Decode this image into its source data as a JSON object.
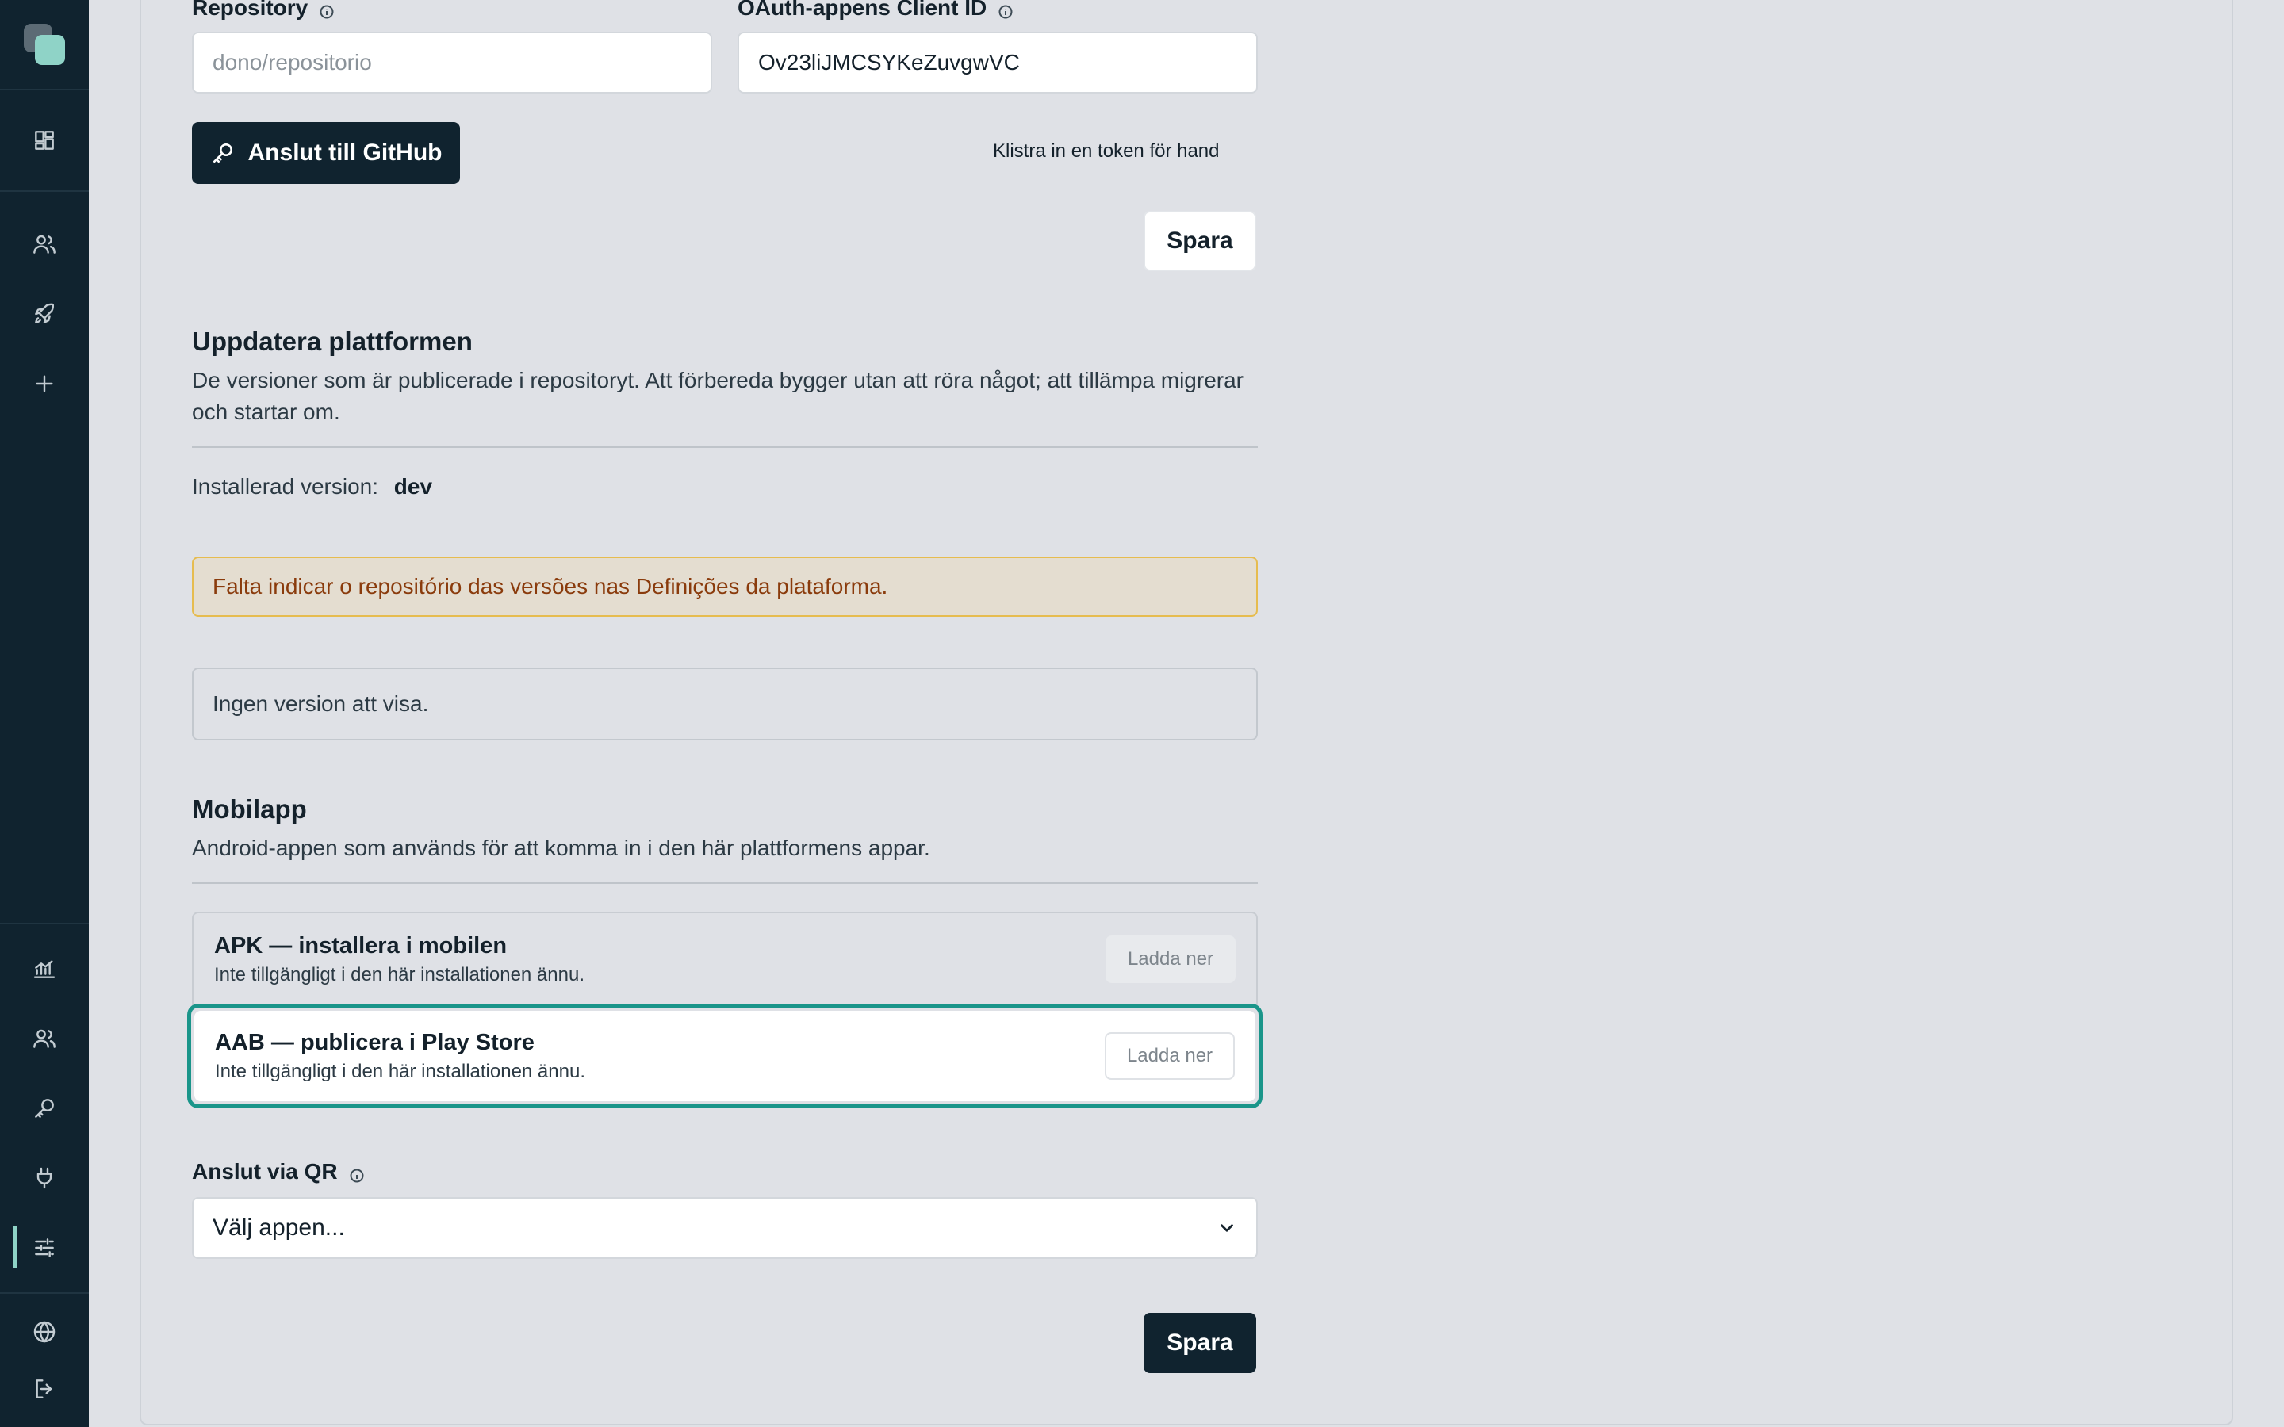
{
  "github": {
    "repository_label": "Repository",
    "repository_placeholder": "dono/repositorio",
    "client_id_label": "OAuth-appens Client ID",
    "client_id_value": "Ov23liJMCSYKeZuvgwVC",
    "connect_button": "Anslut till GitHub",
    "manual_token_link": "Klistra in en token för hand",
    "save_button": "Spara"
  },
  "update": {
    "title": "Uppdatera plattformen",
    "description": "De versioner som är publicerade i repositoryt. Att förbereda bygger utan att röra något; att tillämpa migrerar och startar om.",
    "installed_label": "Installerad version:",
    "installed_value": "dev",
    "alert": "Falta indicar o repositório das versões nas Definições da plataforma.",
    "empty": "Ingen version att visa."
  },
  "mobile": {
    "title": "Mobilapp",
    "description": "Android-appen som används för att komma in i den här plattformens appar.",
    "items": [
      {
        "title": "APK — installera i mobilen",
        "subtitle": "Inte tillgängligt i den här installationen ännu.",
        "button": "Ladda ner"
      },
      {
        "title": "AAB — publicera i Play Store",
        "subtitle": "Inte tillgängligt i den här installationen ännu.",
        "button": "Ladda ner"
      }
    ],
    "qr_label": "Anslut via QR",
    "qr_select": "Välj appen...",
    "save_button": "Spara"
  },
  "sidebar": {
    "icons": [
      "dashboard-icon",
      "users-icon",
      "rocket-icon",
      "plus-icon",
      "analytics-icon",
      "team-icon",
      "key-icon",
      "plug-icon",
      "sliders-icon",
      "globe-icon",
      "logout-icon"
    ],
    "active": "sliders-icon"
  },
  "colors": {
    "sidebar_bg": "#10232f",
    "accent": "#8fd3c7",
    "focus_ring": "#1a958a",
    "alert_border": "#e6bc4f",
    "alert_text": "#8a3b0c"
  }
}
